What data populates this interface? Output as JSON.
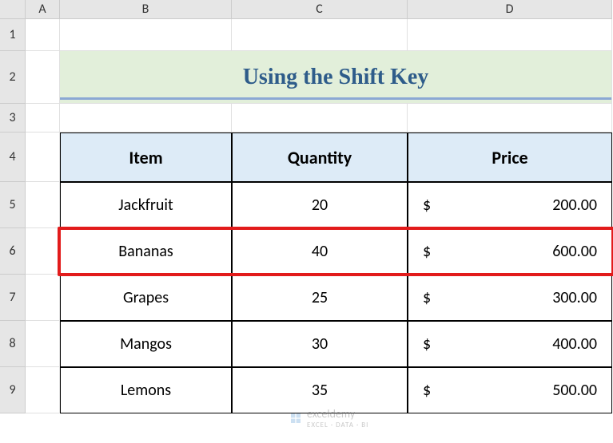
{
  "columns": {
    "A": "A",
    "B": "B",
    "C": "C",
    "D": "D"
  },
  "row_nums": [
    "1",
    "2",
    "3",
    "4",
    "5",
    "6",
    "7",
    "8",
    "9"
  ],
  "title": "Using the Shift Key",
  "headers": {
    "item": "Item",
    "quantity": "Quantity",
    "price": "Price"
  },
  "rows": [
    {
      "item": "Jackfruit",
      "qty": "20",
      "cur": "$",
      "price": "200.00"
    },
    {
      "item": "Bananas",
      "qty": "40",
      "cur": "$",
      "price": "600.00"
    },
    {
      "item": "Grapes",
      "qty": "25",
      "cur": "$",
      "price": "300.00"
    },
    {
      "item": "Mangos",
      "qty": "30",
      "cur": "$",
      "price": "400.00"
    },
    {
      "item": "Lemons",
      "qty": "35",
      "cur": "$",
      "price": "500.00"
    }
  ],
  "watermark": {
    "name": "exceldemy",
    "sub": "EXCEL · DATA · BI"
  },
  "highlight_row_index": 1
}
